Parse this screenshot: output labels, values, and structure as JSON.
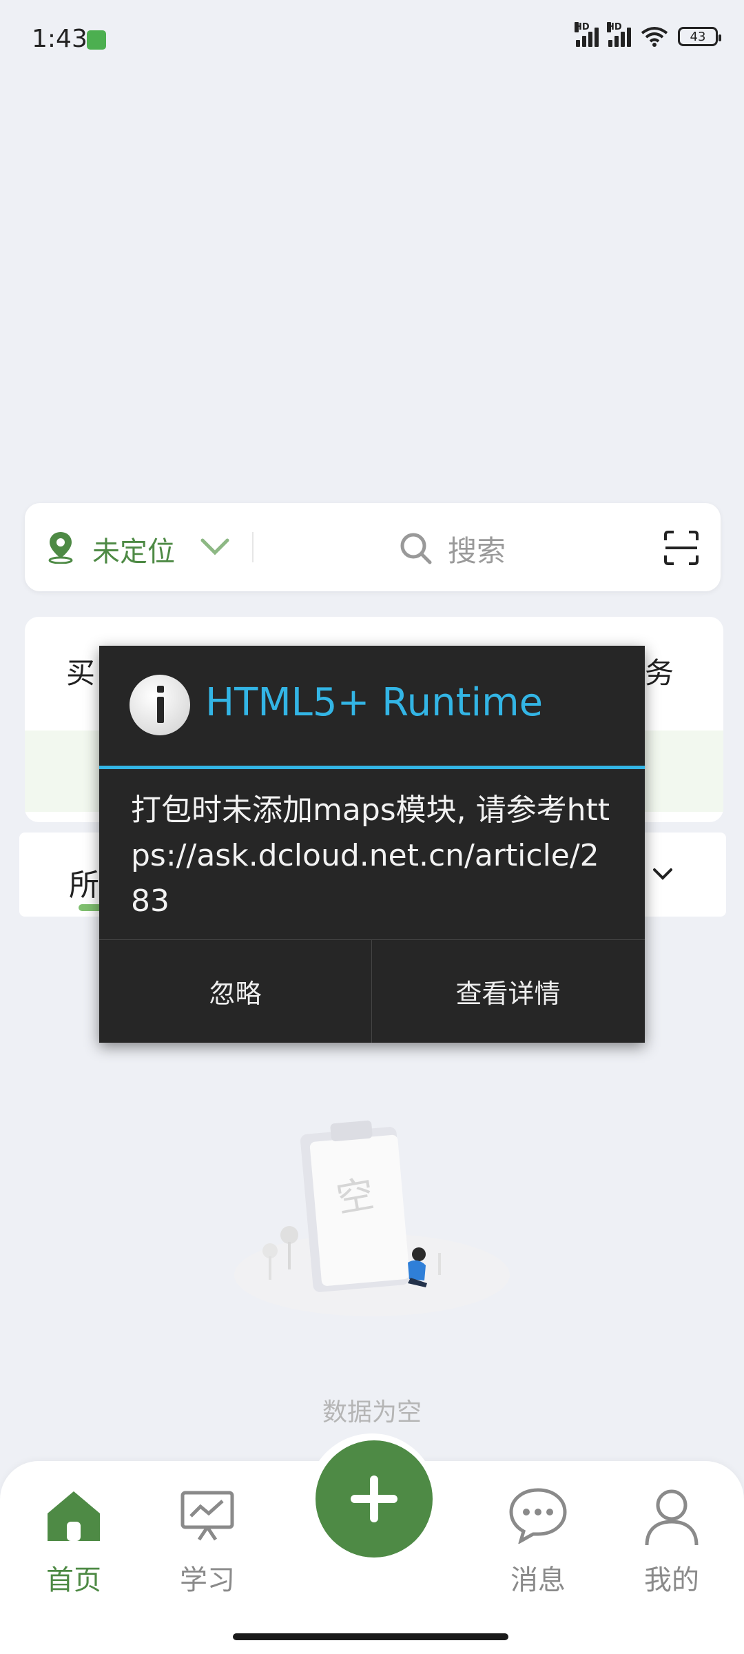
{
  "status_bar": {
    "time": "1:43",
    "battery": "43",
    "hd": "HD"
  },
  "search_bar": {
    "location_label": "未定位",
    "search_placeholder": "搜索"
  },
  "service_card": {
    "left_text": "买",
    "right_text": "务"
  },
  "tabs": {
    "first_tab_partial": "所"
  },
  "empty_state": {
    "illustration_label": "空",
    "text": "数据为空"
  },
  "dialog": {
    "title": "HTML5+ Runtime",
    "message": "打包时未添加maps模块, 请参考https://ask.dcloud.net.cn/article/283",
    "ignore_label": "忽略",
    "details_label": "查看详情"
  },
  "bottom_nav": {
    "items": [
      {
        "label": "首页",
        "icon": "home-icon",
        "active": true
      },
      {
        "label": "学习",
        "icon": "presentation-icon",
        "active": false
      },
      {
        "label": "消息",
        "icon": "chat-bubble-icon",
        "active": false
      },
      {
        "label": "我的",
        "icon": "user-icon",
        "active": false
      }
    ],
    "center_action_icon": "plus-icon"
  },
  "colors": {
    "accent_green": "#4e8a45",
    "dialog_blue": "#33b5e5",
    "dialog_bg": "#262626"
  }
}
